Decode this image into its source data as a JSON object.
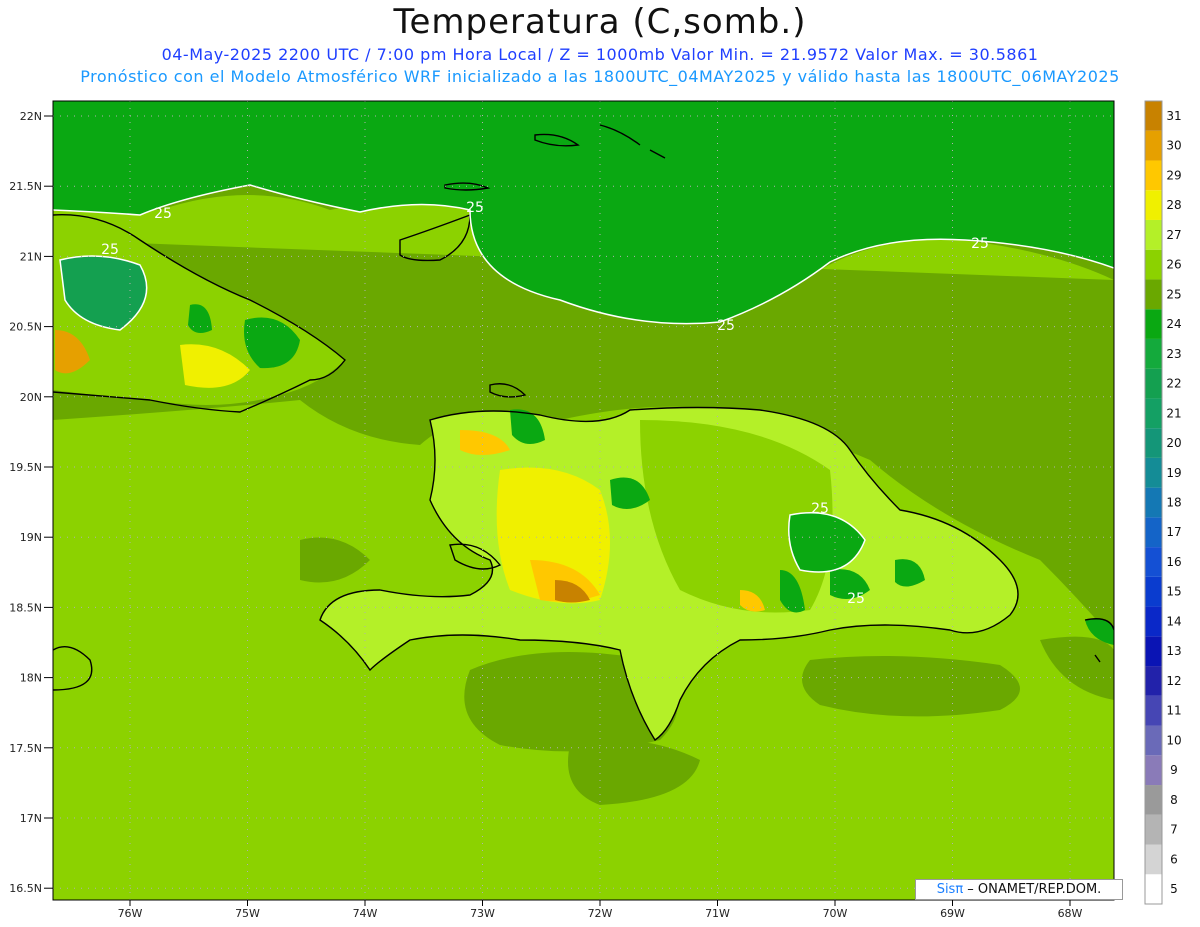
{
  "title": "Temperatura (C,somb.)",
  "subtitle_line1": "04-May-2025  2200 UTC / 7:00 pm Hora Local / Z = 1000mb   Valor Min. = 21.9572  Valor Max. = 30.5861",
  "subtitle_line2": "Pronóstico con el Modelo Atmosférico WRF inicializado a las 1800UTC_04MAY2025 y válido hasta las  1800UTC_06MAY2025",
  "lat_labels": [
    "22N",
    "21.5N",
    "21N",
    "20.5N",
    "20N",
    "19.5N",
    "19N",
    "18.5N",
    "18N",
    "17.5N",
    "17N",
    "16.5N"
  ],
  "lon_labels": [
    "76W",
    "75W",
    "74W",
    "73W",
    "72W",
    "71W",
    "70W",
    "69W",
    "68W"
  ],
  "contour_label": "25",
  "colorbar": [
    {
      "value": "5",
      "color": "#ffffff"
    },
    {
      "value": "6",
      "color": "#d4d4d4"
    },
    {
      "value": "7",
      "color": "#b4b4b4"
    },
    {
      "value": "8",
      "color": "#9a9a9a"
    },
    {
      "value": "9",
      "color": "#8a7bb8"
    },
    {
      "value": "10",
      "color": "#6a6ab8"
    },
    {
      "value": "11",
      "color": "#4646b4"
    },
    {
      "value": "12",
      "color": "#2222aa"
    },
    {
      "value": "13",
      "color": "#0a14b4"
    },
    {
      "value": "14",
      "color": "#0a28c8"
    },
    {
      "value": "15",
      "color": "#0a3ccf"
    },
    {
      "value": "16",
      "color": "#1450d4"
    },
    {
      "value": "17",
      "color": "#1464c8"
    },
    {
      "value": "18",
      "color": "#1478b4"
    },
    {
      "value": "19",
      "color": "#148c96"
    },
    {
      "value": "20",
      "color": "#149678"
    },
    {
      "value": "21",
      "color": "#14a064"
    },
    {
      "value": "22",
      "color": "#14a050"
    },
    {
      "value": "23",
      "color": "#14aa3c"
    },
    {
      "value": "24",
      "color": "#0aa812"
    },
    {
      "value": "25",
      "color": "#6aa800"
    },
    {
      "value": "26",
      "color": "#8cd200"
    },
    {
      "value": "27",
      "color": "#b4f028"
    },
    {
      "value": "28",
      "color": "#f0f000"
    },
    {
      "value": "29",
      "color": "#ffc800"
    },
    {
      "value": "30",
      "color": "#e6a000"
    },
    {
      "value": "31",
      "color": "#c88200"
    }
  ],
  "credit": {
    "logo": "Sisπ",
    "text": " – ONAMET/REP.DOM."
  }
}
